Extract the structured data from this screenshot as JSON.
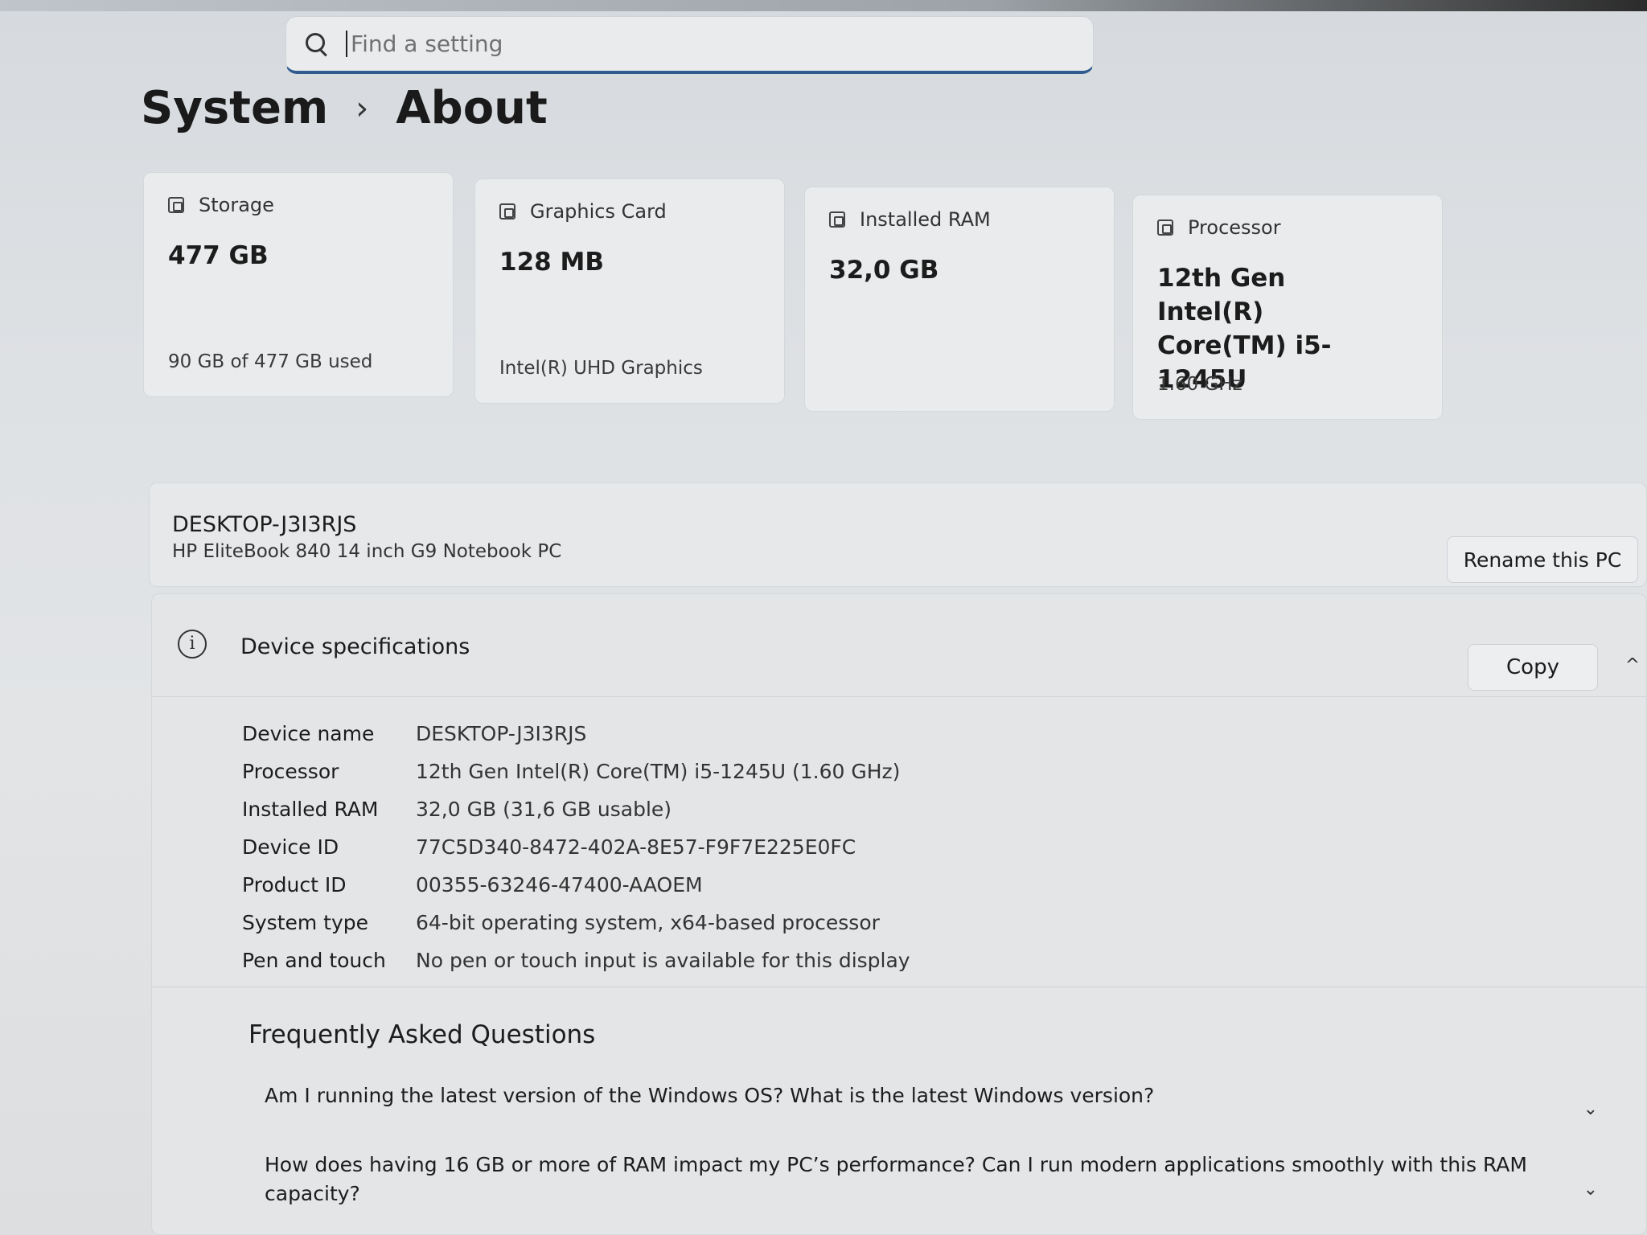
{
  "search": {
    "placeholder": "Find a setting"
  },
  "breadcrumb": {
    "parent": "System",
    "separator": "›",
    "current": "About"
  },
  "cards": [
    {
      "title": "Storage",
      "value": "477 GB",
      "sub": "90 GB of 477 GB used"
    },
    {
      "title": "Graphics Card",
      "value": "128 MB",
      "sub": "Intel(R) UHD Graphics"
    },
    {
      "title": "Installed RAM",
      "value": "32,0 GB",
      "sub": ""
    },
    {
      "title": "Processor",
      "value": "12th Gen Intel(R) Core(TM) i5-1245U",
      "sub": "1.60 GHz"
    }
  ],
  "device": {
    "name": "DESKTOP-J3I3RJS",
    "model": "HP EliteBook 840 14 inch G9 Notebook PC",
    "rename_label": "Rename this PC"
  },
  "specs": {
    "title": "Device specifications",
    "copy_label": "Copy",
    "rows": [
      {
        "key": "Device name",
        "value": "DESKTOP-J3I3RJS"
      },
      {
        "key": "Processor",
        "value": "12th Gen Intel(R) Core(TM) i5-1245U (1.60 GHz)"
      },
      {
        "key": "Installed RAM",
        "value": "32,0 GB (31,6 GB usable)"
      },
      {
        "key": "Device ID",
        "value": "77C5D340-8472-402A-8E57-F9F7E225E0FC"
      },
      {
        "key": "Product ID",
        "value": "00355-63246-47400-AAOEM"
      },
      {
        "key": "System type",
        "value": "64-bit operating system, x64-based processor"
      },
      {
        "key": "Pen and touch",
        "value": "No pen or touch input is available for this display"
      }
    ]
  },
  "faq": {
    "title": "Frequently Asked Questions",
    "items": [
      "Am I running the latest version of the Windows OS? What is the latest Windows version?",
      "How does having 16 GB or more of RAM impact my PC’s performance? Can I run modern applications smoothly with this RAM capacity?"
    ]
  }
}
